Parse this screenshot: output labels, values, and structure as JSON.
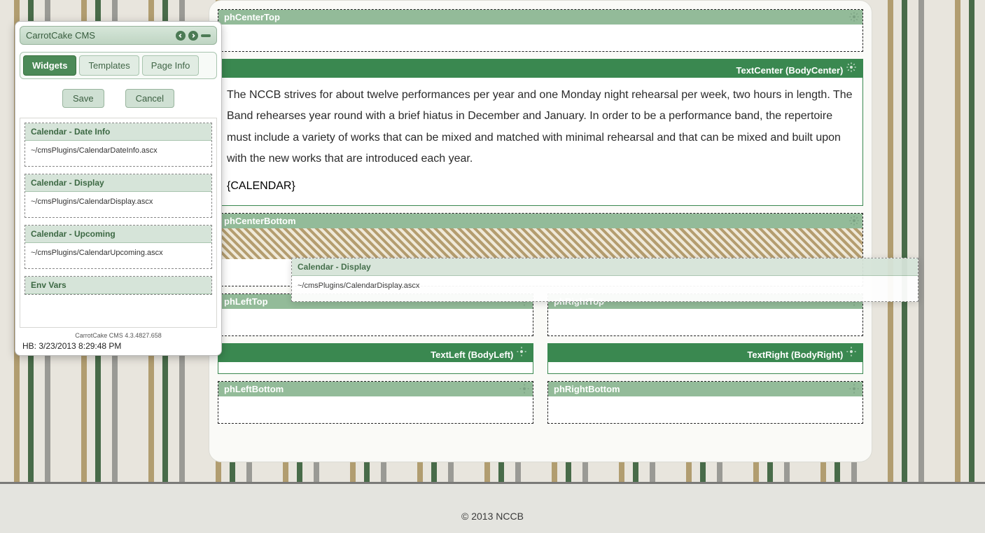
{
  "toolbox": {
    "title": "CarrotCake CMS",
    "tabs": {
      "widgets": "Widgets",
      "templates": "Templates",
      "pageinfo": "Page Info"
    },
    "buttons": {
      "save": "Save",
      "cancel": "Cancel"
    },
    "widgets": [
      {
        "name": "Calendar - Date Info",
        "path": "~/cmsPlugins/CalendarDateInfo.ascx"
      },
      {
        "name": "Calendar - Display",
        "path": "~/cmsPlugins/CalendarDisplay.ascx"
      },
      {
        "name": "Calendar - Upcoming",
        "path": "~/cmsPlugins/CalendarUpcoming.ascx"
      },
      {
        "name": "Env Vars",
        "path": ""
      }
    ],
    "version": "CarrotCake CMS 4.3.4827.658",
    "heartbeat": "HB: 3/23/2013 8:29:48 PM"
  },
  "drag": {
    "name": "Calendar - Display",
    "path": "~/cmsPlugins/CalendarDisplay.ascx"
  },
  "zones": {
    "centerTop": "phCenterTop",
    "textCenter": "TextCenter (BodyCenter)",
    "centerBottom": "phCenterBottom",
    "leftTop": "phLeftTop",
    "rightTop": "phRightTop",
    "textLeft": "TextLeft (BodyLeft)",
    "textRight": "TextRight (BodyRight)",
    "leftBottom": "phLeftBottom",
    "rightBottom": "phRightBottom"
  },
  "content": {
    "paragraph": "The NCCB strives for about twelve performances per year and one Monday night rehearsal per week, two hours in length. The Band rehearses year round with a brief hiatus in December and January. In order to be a performance band, the repertoire must include a variety of works that can be mixed and matched with minimal rehearsal and that can be mixed and built upon with the new works that are introduced each year.",
    "calendar_token": "{CALENDAR}"
  },
  "footer": "© 2013 NCCB"
}
